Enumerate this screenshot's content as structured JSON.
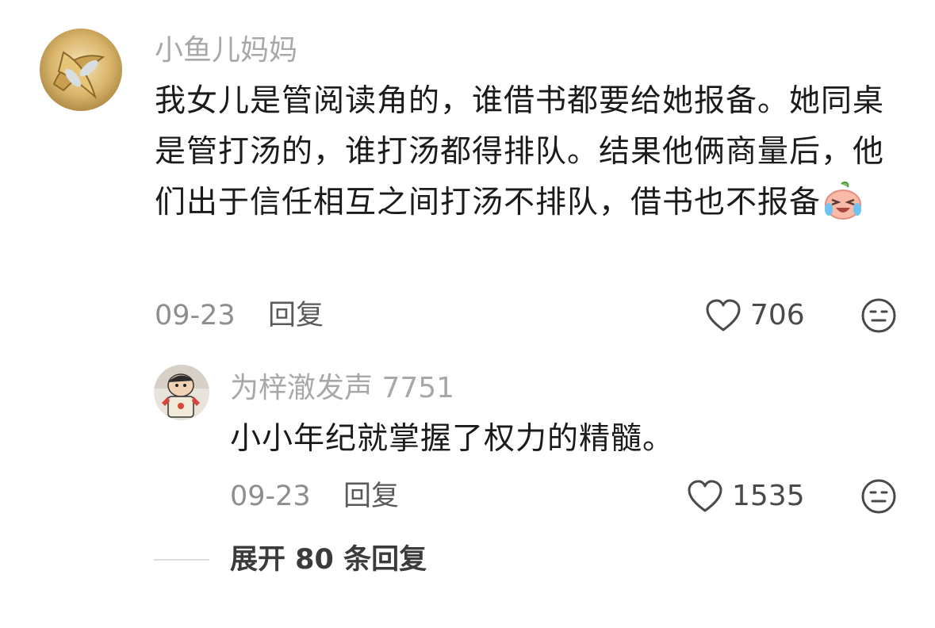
{
  "comment": {
    "username": "小鱼儿妈妈",
    "text": "我女儿是管阅读角的，谁借书都要给她报备。她同桌是管打汤的，谁打汤都得排队。结果他俩商量后，他们出于信任相互之间打汤不排队，借书也不报备",
    "date": "09-23",
    "reply_label": "回复",
    "likes": "706"
  },
  "reply": {
    "username": "为梓澈发声 7751",
    "text": "小小年纪就掌握了权力的精髓。",
    "date": "09-23",
    "reply_label": "回复",
    "likes": "1535"
  },
  "expand": {
    "label": "展开 80 条回复"
  }
}
